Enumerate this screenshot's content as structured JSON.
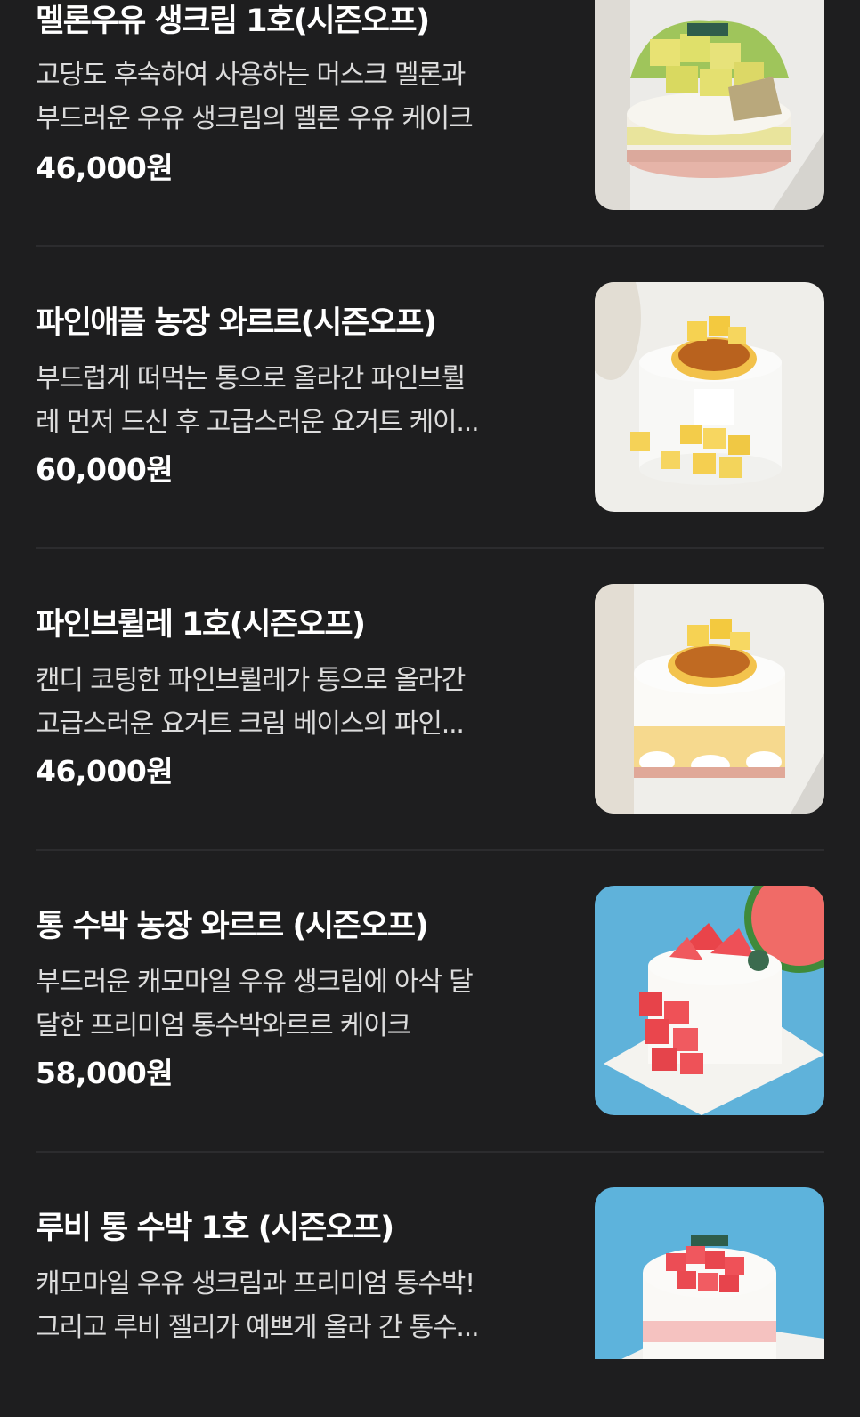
{
  "menu": {
    "items": [
      {
        "name": "멜론우유 생크림 1호(시즌오프)",
        "desc_lines": [
          "고당도 후숙하여 사용하는 머스크 멜론과",
          "부드러운 우유 생크림의 멜론 우유 케이크"
        ],
        "price": "46,000원",
        "image_icon": "melon-cake-image"
      },
      {
        "name": "파인애플 농장 와르르(시즌오프)",
        "desc_lines": [
          "부드럽게 떠먹는 통으로 올라간 파인브륄",
          "레 먼저 드신 후 고급스러운 요거트 케이..."
        ],
        "price": "60,000원",
        "image_icon": "pineapple-cake-image"
      },
      {
        "name": "파인브륄레 1호(시즌오프)",
        "desc_lines": [
          "캔디 코팅한 파인브륄레가 통으로 올라간",
          "고급스러운 요거트 크림 베이스의 파인..."
        ],
        "price": "46,000원",
        "image_icon": "pineapple-brulee-cake-image"
      },
      {
        "name": "통 수박 농장 와르르 (시즌오프)",
        "desc_lines": [
          "부드러운 캐모마일 우유 생크림에 아삭 달",
          "달한 프리미엄 통수박와르르 케이크"
        ],
        "price": "58,000원",
        "image_icon": "watermelon-cake-image"
      },
      {
        "name": "루비 통 수박 1호 (시즌오프)",
        "desc_lines": [
          "캐모마일 우유 생크림과 프리미엄 통수박!",
          "그리고 루비 젤리가 예쁘게 올라 간 통수..."
        ],
        "price": "",
        "image_icon": "ruby-watermelon-cake-image"
      }
    ]
  },
  "colors": {
    "background": "#1e1e1f",
    "divider": "#2c2c2e",
    "title": "#ffffff",
    "description": "#dcdcdc",
    "price": "#ffffff"
  }
}
